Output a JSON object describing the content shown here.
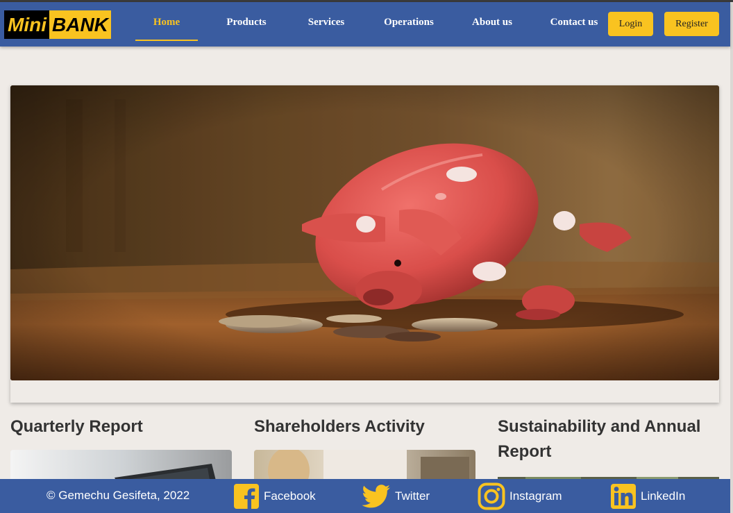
{
  "brand": {
    "part1": "Mini",
    "part2": "BANK"
  },
  "nav": {
    "items": [
      {
        "label": "Home",
        "active": true
      },
      {
        "label": "Products"
      },
      {
        "label": "Services"
      },
      {
        "label": "Operations"
      },
      {
        "label": "About us"
      },
      {
        "label": "Contact us"
      }
    ],
    "login_label": "Login",
    "register_label": "Register"
  },
  "hero": {
    "image": "piggy-bank-with-coins"
  },
  "sections": [
    {
      "title": "Quarterly Report",
      "image": "laptop-photo"
    },
    {
      "title": "Shareholders Activity",
      "image": "person-photo"
    },
    {
      "title": "Sustainability and Annual Report",
      "image": "nature-photo"
    }
  ],
  "footer": {
    "copyright": "© Gemechu Gesifeta, 2022",
    "social": [
      {
        "label": "Facebook",
        "icon": "facebook-icon"
      },
      {
        "label": "Twitter",
        "icon": "twitter-icon"
      },
      {
        "label": "Instagram",
        "icon": "instagram-icon"
      },
      {
        "label": "LinkedIn",
        "icon": "linkedin-icon"
      }
    ]
  },
  "colors": {
    "primary": "#3a5ca0",
    "accent": "#f9c320",
    "background": "#efebe7",
    "text": "#333333"
  }
}
